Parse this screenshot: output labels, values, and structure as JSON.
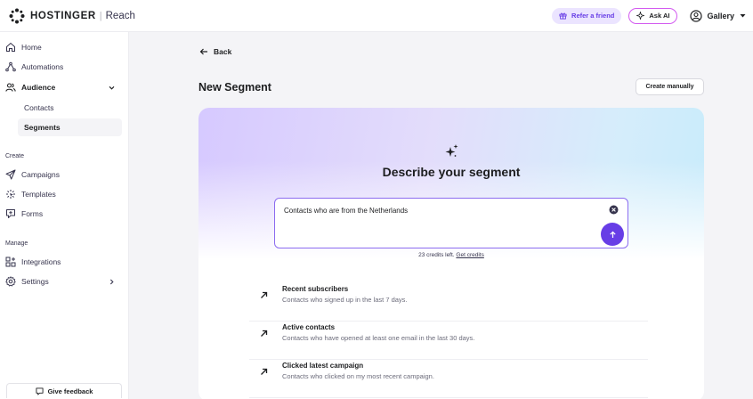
{
  "header": {
    "brand": "HOSTINGER",
    "separator": "|",
    "product": "Reach",
    "refer_label": "Refer a friend",
    "ask_ai_label": "Ask AI",
    "account_label": "Gallery"
  },
  "sidebar": {
    "items": [
      {
        "label": "Home",
        "icon": "home-icon"
      },
      {
        "label": "Automations",
        "icon": "automations-icon"
      },
      {
        "label": "Audience",
        "icon": "audience-icon",
        "expanded": true
      }
    ],
    "audience_sub": [
      {
        "label": "Contacts"
      },
      {
        "label": "Segments",
        "active": true
      }
    ],
    "create_label": "Create",
    "create_items": [
      {
        "label": "Campaigns",
        "icon": "send-icon"
      },
      {
        "label": "Templates",
        "icon": "templates-icon"
      },
      {
        "label": "Forms",
        "icon": "forms-icon"
      }
    ],
    "manage_label": "Manage",
    "manage_items": [
      {
        "label": "Integrations",
        "icon": "integrations-icon"
      },
      {
        "label": "Settings",
        "icon": "gear-icon"
      }
    ],
    "feedback_label": "Give feedback"
  },
  "main": {
    "back_label": "Back",
    "title": "New Segment",
    "create_manually_label": "Create manually",
    "card_title": "Describe your segment",
    "prompt_value": "Contacts who are from the Netherlands",
    "credits_text": "23 credits left.",
    "get_credits_label": "Get credits",
    "suggestions": [
      {
        "title": "Recent subscribers",
        "desc": "Contacts who signed up in the last 7 days."
      },
      {
        "title": "Active contacts",
        "desc": "Contacts who have opened at least one email in the last 30 days."
      },
      {
        "title": "Clicked latest campaign",
        "desc": "Contacts who clicked on my most recent campaign."
      }
    ]
  },
  "colors": {
    "accent": "#673de6",
    "accent_light": "#ebe4ff",
    "ai_border": "#d35af0"
  }
}
